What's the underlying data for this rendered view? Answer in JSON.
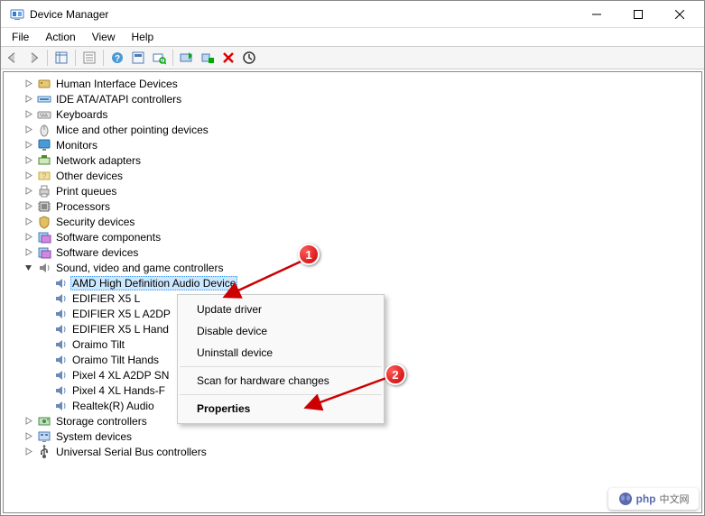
{
  "window": {
    "title": "Device Manager"
  },
  "menubar": [
    "File",
    "Action",
    "View",
    "Help"
  ],
  "tree": {
    "categories": [
      {
        "label": "Human Interface Devices",
        "icon": "hid"
      },
      {
        "label": "IDE ATA/ATAPI controllers",
        "icon": "ide"
      },
      {
        "label": "Keyboards",
        "icon": "keyboard"
      },
      {
        "label": "Mice and other pointing devices",
        "icon": "mouse"
      },
      {
        "label": "Monitors",
        "icon": "monitor"
      },
      {
        "label": "Network adapters",
        "icon": "network"
      },
      {
        "label": "Other devices",
        "icon": "other"
      },
      {
        "label": "Print queues",
        "icon": "print"
      },
      {
        "label": "Processors",
        "icon": "processor"
      },
      {
        "label": "Security devices",
        "icon": "security"
      },
      {
        "label": "Software components",
        "icon": "software"
      },
      {
        "label": "Software devices",
        "icon": "software"
      },
      {
        "label": "Sound, video and game controllers",
        "icon": "sound",
        "expanded": true,
        "children": [
          {
            "label": "AMD High Definition Audio Device",
            "selected": true
          },
          {
            "label": "EDIFIER X5 L"
          },
          {
            "label": "EDIFIER X5 L A2DP"
          },
          {
            "label": "EDIFIER X5 L Hand"
          },
          {
            "label": "Oraimo Tilt"
          },
          {
            "label": "Oraimo Tilt Hands"
          },
          {
            "label": "Pixel 4 XL A2DP SN"
          },
          {
            "label": "Pixel 4 XL Hands-F"
          },
          {
            "label": "Realtek(R) Audio"
          }
        ]
      },
      {
        "label": "Storage controllers",
        "icon": "storage"
      },
      {
        "label": "System devices",
        "icon": "system"
      },
      {
        "label": "Universal Serial Bus controllers",
        "icon": "usb"
      }
    ]
  },
  "context_menu": {
    "items": [
      {
        "label": "Update driver"
      },
      {
        "label": "Disable device"
      },
      {
        "label": "Uninstall device"
      },
      {
        "sep": true
      },
      {
        "label": "Scan for hardware changes"
      },
      {
        "sep": true
      },
      {
        "label": "Properties",
        "bold": true
      }
    ]
  },
  "annotations": {
    "callout1": "1",
    "callout2": "2"
  },
  "watermark": {
    "brand": "php",
    "text": "中文网"
  }
}
